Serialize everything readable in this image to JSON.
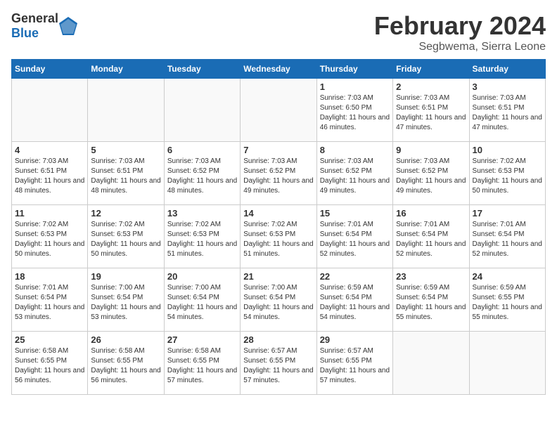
{
  "header": {
    "logo_general": "General",
    "logo_blue": "Blue",
    "month_title": "February 2024",
    "location": "Segbwema, Sierra Leone"
  },
  "days_of_week": [
    "Sunday",
    "Monday",
    "Tuesday",
    "Wednesday",
    "Thursday",
    "Friday",
    "Saturday"
  ],
  "weeks": [
    [
      {
        "day": "",
        "empty": true
      },
      {
        "day": "",
        "empty": true
      },
      {
        "day": "",
        "empty": true
      },
      {
        "day": "",
        "empty": true
      },
      {
        "day": "1",
        "sunrise": "7:03 AM",
        "sunset": "6:50 PM",
        "daylight": "11 hours and 46 minutes."
      },
      {
        "day": "2",
        "sunrise": "7:03 AM",
        "sunset": "6:51 PM",
        "daylight": "11 hours and 47 minutes."
      },
      {
        "day": "3",
        "sunrise": "7:03 AM",
        "sunset": "6:51 PM",
        "daylight": "11 hours and 47 minutes."
      }
    ],
    [
      {
        "day": "4",
        "sunrise": "7:03 AM",
        "sunset": "6:51 PM",
        "daylight": "11 hours and 48 minutes."
      },
      {
        "day": "5",
        "sunrise": "7:03 AM",
        "sunset": "6:51 PM",
        "daylight": "11 hours and 48 minutes."
      },
      {
        "day": "6",
        "sunrise": "7:03 AM",
        "sunset": "6:52 PM",
        "daylight": "11 hours and 48 minutes."
      },
      {
        "day": "7",
        "sunrise": "7:03 AM",
        "sunset": "6:52 PM",
        "daylight": "11 hours and 49 minutes."
      },
      {
        "day": "8",
        "sunrise": "7:03 AM",
        "sunset": "6:52 PM",
        "daylight": "11 hours and 49 minutes."
      },
      {
        "day": "9",
        "sunrise": "7:03 AM",
        "sunset": "6:52 PM",
        "daylight": "11 hours and 49 minutes."
      },
      {
        "day": "10",
        "sunrise": "7:02 AM",
        "sunset": "6:53 PM",
        "daylight": "11 hours and 50 minutes."
      }
    ],
    [
      {
        "day": "11",
        "sunrise": "7:02 AM",
        "sunset": "6:53 PM",
        "daylight": "11 hours and 50 minutes."
      },
      {
        "day": "12",
        "sunrise": "7:02 AM",
        "sunset": "6:53 PM",
        "daylight": "11 hours and 50 minutes."
      },
      {
        "day": "13",
        "sunrise": "7:02 AM",
        "sunset": "6:53 PM",
        "daylight": "11 hours and 51 minutes."
      },
      {
        "day": "14",
        "sunrise": "7:02 AM",
        "sunset": "6:53 PM",
        "daylight": "11 hours and 51 minutes."
      },
      {
        "day": "15",
        "sunrise": "7:01 AM",
        "sunset": "6:54 PM",
        "daylight": "11 hours and 52 minutes."
      },
      {
        "day": "16",
        "sunrise": "7:01 AM",
        "sunset": "6:54 PM",
        "daylight": "11 hours and 52 minutes."
      },
      {
        "day": "17",
        "sunrise": "7:01 AM",
        "sunset": "6:54 PM",
        "daylight": "11 hours and 52 minutes."
      }
    ],
    [
      {
        "day": "18",
        "sunrise": "7:01 AM",
        "sunset": "6:54 PM",
        "daylight": "11 hours and 53 minutes."
      },
      {
        "day": "19",
        "sunrise": "7:00 AM",
        "sunset": "6:54 PM",
        "daylight": "11 hours and 53 minutes."
      },
      {
        "day": "20",
        "sunrise": "7:00 AM",
        "sunset": "6:54 PM",
        "daylight": "11 hours and 54 minutes."
      },
      {
        "day": "21",
        "sunrise": "7:00 AM",
        "sunset": "6:54 PM",
        "daylight": "11 hours and 54 minutes."
      },
      {
        "day": "22",
        "sunrise": "6:59 AM",
        "sunset": "6:54 PM",
        "daylight": "11 hours and 54 minutes."
      },
      {
        "day": "23",
        "sunrise": "6:59 AM",
        "sunset": "6:54 PM",
        "daylight": "11 hours and 55 minutes."
      },
      {
        "day": "24",
        "sunrise": "6:59 AM",
        "sunset": "6:55 PM",
        "daylight": "11 hours and 55 minutes."
      }
    ],
    [
      {
        "day": "25",
        "sunrise": "6:58 AM",
        "sunset": "6:55 PM",
        "daylight": "11 hours and 56 minutes."
      },
      {
        "day": "26",
        "sunrise": "6:58 AM",
        "sunset": "6:55 PM",
        "daylight": "11 hours and 56 minutes."
      },
      {
        "day": "27",
        "sunrise": "6:58 AM",
        "sunset": "6:55 PM",
        "daylight": "11 hours and 57 minutes."
      },
      {
        "day": "28",
        "sunrise": "6:57 AM",
        "sunset": "6:55 PM",
        "daylight": "11 hours and 57 minutes."
      },
      {
        "day": "29",
        "sunrise": "6:57 AM",
        "sunset": "6:55 PM",
        "daylight": "11 hours and 57 minutes."
      },
      {
        "day": "",
        "empty": true
      },
      {
        "day": "",
        "empty": true
      }
    ]
  ]
}
